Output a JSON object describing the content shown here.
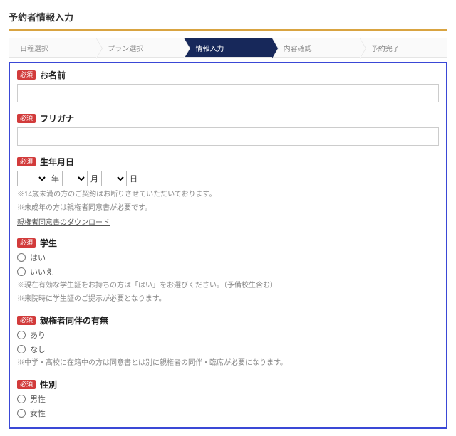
{
  "page_title": "予約者情報入力",
  "required_badge": "必須",
  "steps": [
    {
      "label": "日程選択",
      "active": false
    },
    {
      "label": "プラン選択",
      "active": false
    },
    {
      "label": "情報入力",
      "active": true
    },
    {
      "label": "内容確認",
      "active": false
    },
    {
      "label": "予約完了",
      "active": false
    }
  ],
  "fields": {
    "name": {
      "label": "お名前",
      "value": ""
    },
    "kana": {
      "label": "フリガナ",
      "value": ""
    },
    "birthdate": {
      "label": "生年月日",
      "year_suffix": "年",
      "month_suffix": "月",
      "day_suffix": "日",
      "year_value": "",
      "month_value": "",
      "day_value": "",
      "note1": "※14歳未満の方のご契約はお断りさせていただいております。",
      "note2": "※未成年の方は親権者同意書が必要です。",
      "download_link": "親権者同意書のダウンロード"
    },
    "student": {
      "label": "学生",
      "option_yes": "はい",
      "option_no": "いいえ",
      "note1": "※現在有効な学生証をお持ちの方は「はい」をお選びください。（予備校生含む）",
      "note2": "※来院時に学生証のご提示が必要となります。"
    },
    "guardian": {
      "label": "親権者同伴の有無",
      "option_yes": "あり",
      "option_no": "なし",
      "note": "※中学・高校に在籍中の方は同意書とは別に親権者の同伴・臨席が必要になります。"
    },
    "gender": {
      "label": "性別",
      "option_male": "男性",
      "option_female": "女性"
    }
  }
}
